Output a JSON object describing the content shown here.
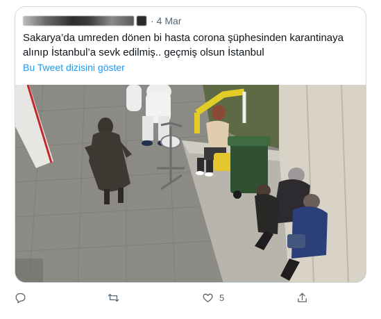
{
  "quoted_tweet": {
    "date": "4 Mar",
    "separator": "·",
    "text": "Sakarya’da umreden dönen bi hasta corona şüphesinden karantinaya alınıp İstanbul’a sevk edilmiş.. geçmiş olsun İstanbul",
    "thread_link": "Bu Tweet dizisini göster",
    "media_description": "photo"
  },
  "actions": {
    "reply_icon": "reply-icon",
    "retweet_icon": "retweet-icon",
    "like_icon": "heart-icon",
    "like_count": "5",
    "share_icon": "share-icon"
  },
  "colors": {
    "link": "#1d9bf0",
    "secondary_text": "#536471",
    "border": "#cfd9de"
  }
}
